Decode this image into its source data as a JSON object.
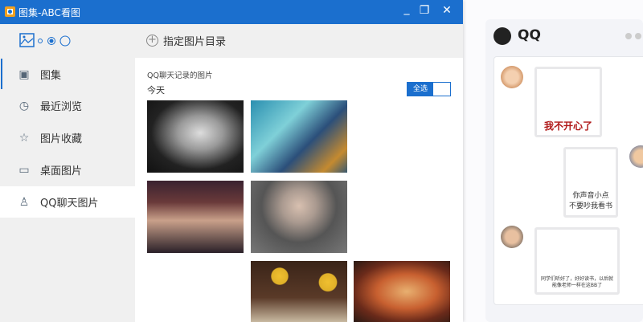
{
  "window": {
    "title": "图集-ABC看图",
    "minimize": "_",
    "restore": "❐",
    "close": "✕"
  },
  "toolbar": {
    "add_directory": "指定图片目录",
    "plus": "+"
  },
  "sidebar": {
    "items": [
      {
        "label": "图集",
        "icon": "album-icon",
        "glyph": "▣"
      },
      {
        "label": "最近浏览",
        "icon": "clock-icon",
        "glyph": "◷"
      },
      {
        "label": "图片收藏",
        "icon": "star-icon",
        "glyph": "☆"
      },
      {
        "label": "桌面图片",
        "icon": "monitor-icon",
        "glyph": "▭"
      },
      {
        "label": "QQ聊天图片",
        "icon": "qq-icon",
        "glyph": "♙"
      }
    ]
  },
  "content": {
    "source": "QQ聊天记录的图片",
    "group": "今天",
    "select_all": "全选"
  },
  "qq_panel": {
    "title": "QQ",
    "messages": [
      {
        "caption": "我不开心了"
      },
      {
        "caption": "你声音小点\n不要吵我看书"
      },
      {
        "caption": "同学们听好了，好好读书，以后就能像老师一样在这BB了"
      }
    ]
  },
  "colors": {
    "accent": "#1b6fce",
    "sidebar_bg": "#f0f0f0"
  }
}
